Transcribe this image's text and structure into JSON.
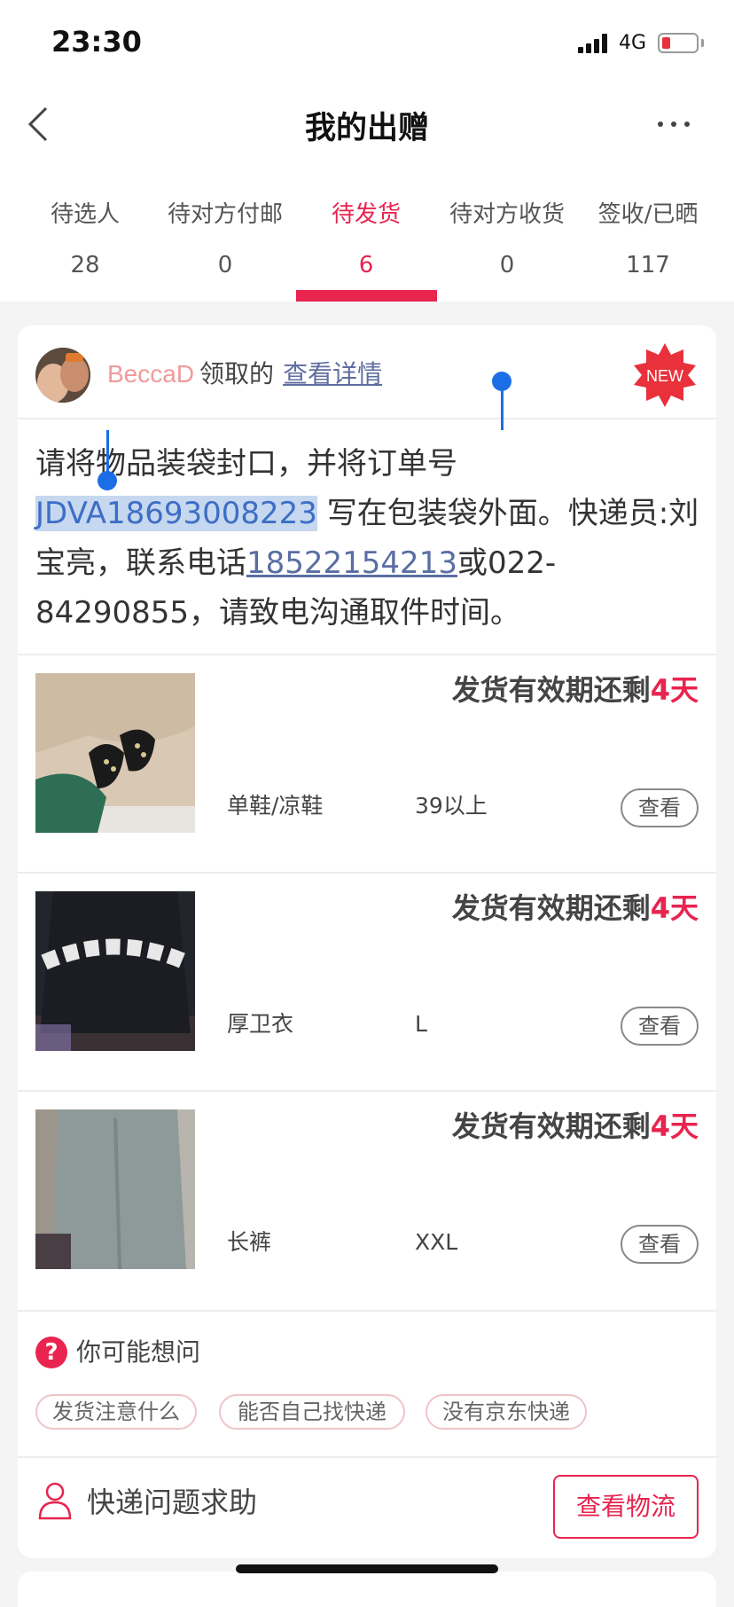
{
  "status_bar": {
    "time": "23:30",
    "network": "4G"
  },
  "nav": {
    "title": "我的出赠"
  },
  "tabs": [
    {
      "label": "待选人",
      "count": "28"
    },
    {
      "label": "待对方付邮",
      "count": "0"
    },
    {
      "label": "待发货",
      "count": "6",
      "active": true
    },
    {
      "label": "待对方收货",
      "count": "0"
    },
    {
      "label": "签收/已晒",
      "count": "117"
    }
  ],
  "card": {
    "username": "BeccaD",
    "action": "领取的",
    "detail_link": "查看详情",
    "badge": "NEW",
    "notice": {
      "part1": "请将物品装袋封口，并将订单号",
      "order_no": "JDVA18693008223",
      "part2": "写在包装袋外面。快递员:刘宝亮，联系电话",
      "phone": "18522154213",
      "part3": "或022-84290855，请致电沟通取件时间。"
    },
    "items": [
      {
        "deadline_prefix": "发货有效期还剩",
        "days": "4天",
        "category": "单鞋/凉鞋",
        "size": "39以上",
        "view": "查看"
      },
      {
        "deadline_prefix": "发货有效期还剩",
        "days": "4天",
        "category": "厚卫衣",
        "size": "L",
        "view": "查看"
      },
      {
        "deadline_prefix": "发货有效期还剩",
        "days": "4天",
        "category": "长裤",
        "size": "XXL",
        "view": "查看"
      }
    ],
    "faq": {
      "title": "你可能想问",
      "chips": [
        "发货注意什么",
        "能否自己找快递",
        "没有京东快递"
      ]
    },
    "help": {
      "label": "快递问题求助",
      "logistics_button": "查看物流"
    }
  },
  "colors": {
    "accent": "#e8244f",
    "link": "#5f6ea0",
    "selection": "#c6d8ef",
    "handle": "#1b6ee6"
  }
}
